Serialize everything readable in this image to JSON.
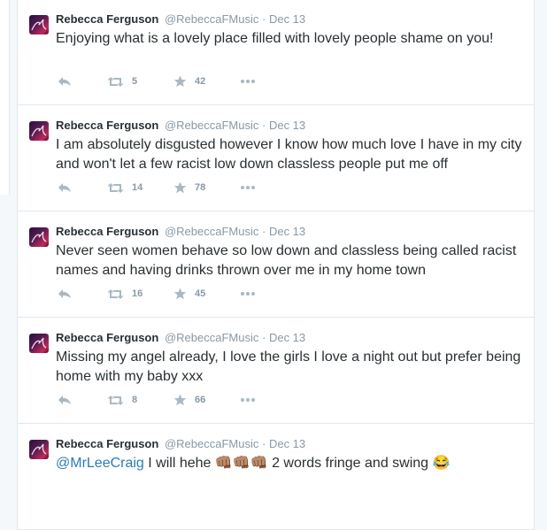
{
  "tweets": [
    {
      "name": "Rebecca Ferguson",
      "handle": "@RebeccaFMusic",
      "separator": "·",
      "date": "Dec 13",
      "text": "Enjoying what is a lovely place filled with lovely people shame on you!",
      "retweets": "5",
      "favorites": "42"
    },
    {
      "name": "Rebecca Ferguson",
      "handle": "@RebeccaFMusic",
      "separator": "·",
      "date": "Dec 13",
      "text": "I am absolutely disgusted however I know how much love I have in my city and won't let a few racist low down classless people put me off",
      "retweets": "14",
      "favorites": "78"
    },
    {
      "name": "Rebecca Ferguson",
      "handle": "@RebeccaFMusic",
      "separator": "·",
      "date": "Dec 13",
      "text": "Never seen women behave so low down and classless being called racist names and having drinks thrown over me in my home town",
      "retweets": "16",
      "favorites": "45"
    },
    {
      "name": "Rebecca Ferguson",
      "handle": "@RebeccaFMusic",
      "separator": "·",
      "date": "Dec 13",
      "text": "Missing my angel already, I love the girls I love a night out but prefer being home with my baby xxx",
      "retweets": "8",
      "favorites": "66"
    },
    {
      "name": "Rebecca Ferguson",
      "handle": "@RebeccaFMusic",
      "separator": "·",
      "date": "Dec 13",
      "mention": "@MrLeeCraig",
      "text": "I will hehe 👊🏽👊🏽👊🏽 2 words fringe and swing 😂"
    }
  ],
  "icons": {
    "reply": "reply-icon",
    "retweet": "retweet-icon",
    "favorite": "star-icon",
    "more": "more-icon"
  },
  "colors": {
    "name": "#292f33",
    "meta": "#8899a6",
    "action": "#aab8c2",
    "mention": "#2b7bb9",
    "border": "#e1e8ed"
  }
}
